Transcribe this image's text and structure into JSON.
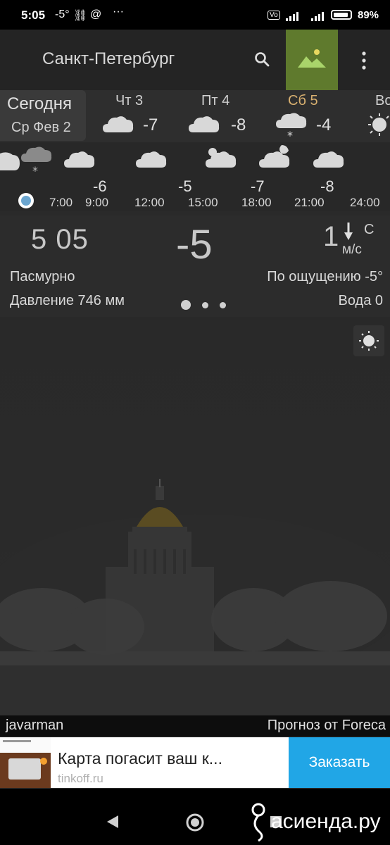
{
  "status_bar": {
    "time": "5:05",
    "weather_temp": "-5°",
    "battery": "89%"
  },
  "app_bar": {
    "city": "Санкт-Петербург"
  },
  "days": [
    {
      "label": "Сегодня",
      "date": "Ср Фев 2"
    },
    {
      "label": "Чт 3",
      "temp": "-7",
      "icon": "cloud-icon"
    },
    {
      "label": "Пт 4",
      "temp": "-8",
      "icon": "cloud-icon"
    },
    {
      "label": "Сб 5",
      "temp": "-4",
      "icon": "snow-cloud-icon"
    },
    {
      "label": "Во",
      "icon": "sun-icon"
    }
  ],
  "hourly": {
    "temps": [
      "-6",
      "-5",
      "-7",
      "-8"
    ],
    "times": [
      "7:00",
      "9:00",
      "12:00",
      "15:00",
      "18:00",
      "21:00",
      "24:00"
    ]
  },
  "current": {
    "time": "5 05",
    "temp": "-5",
    "wind_speed": "1",
    "wind_dir": "С",
    "wind_unit": "м/с",
    "condition": "Пасмурно",
    "feels_like": "По ощущению -5°",
    "pressure": "Давление 746 мм",
    "water": "Вода 0"
  },
  "footer": {
    "author": "javarman",
    "source": "Прогноз от Foreca"
  },
  "ad": {
    "title": "Карта погасит ваш к...",
    "url": "tinkoff.ru",
    "button": "Заказать"
  },
  "watermark": "асиенда.ру",
  "colors": {
    "accent_photo_button": "#5f7a2d",
    "saturday": "#d8b070",
    "ad_button": "#21a6e6"
  }
}
